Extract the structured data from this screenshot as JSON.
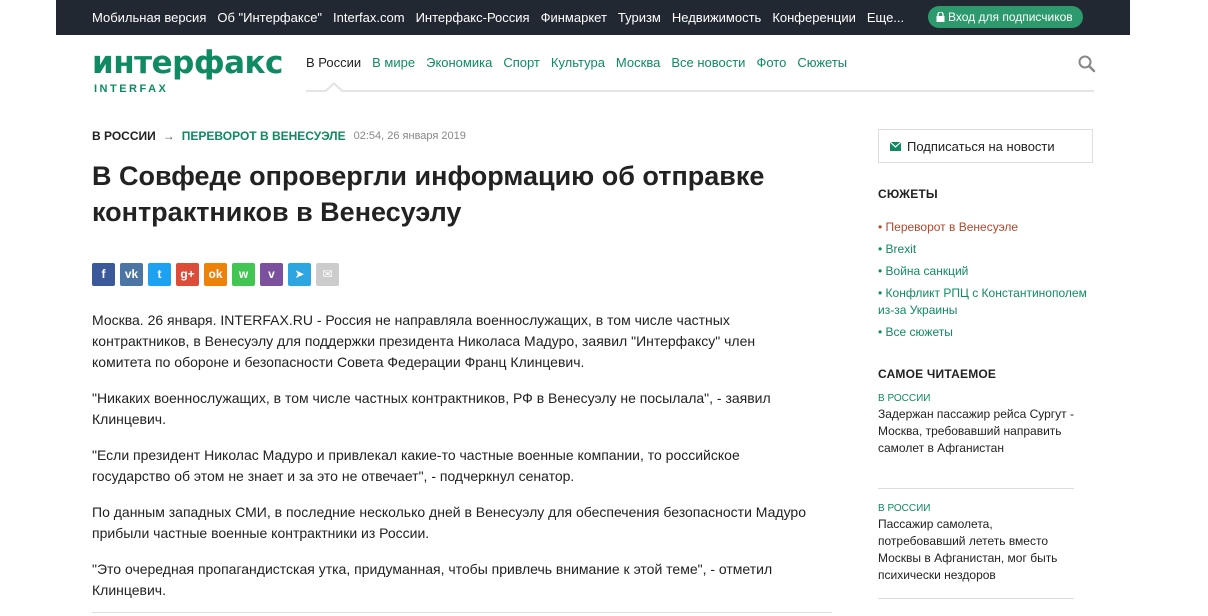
{
  "top_nav": {
    "links": [
      "Мобильная версия",
      "Об \"Интерфаксе\"",
      "Interfax.com",
      "Интерфакс-Россия",
      "Финмаркет",
      "Туризм",
      "Недвижимость",
      "Конференции",
      "Еще..."
    ],
    "subscribe_label": "Вход для подписчиков"
  },
  "logo": {
    "main": "интерфакс",
    "sub": "INTERFAX"
  },
  "main_nav": {
    "items": [
      "В России",
      "В мире",
      "Экономика",
      "Спорт",
      "Культура",
      "Москва",
      "Все новости",
      "Фото",
      "Сюжеты"
    ],
    "active_index": 0
  },
  "breadcrumb": {
    "section": "В РОССИИ",
    "arrow": "→",
    "story": "ПЕРЕВОРОТ В ВЕНЕСУЭЛЕ",
    "datetime": "02:54, 26 января 2019"
  },
  "article": {
    "headline": "В Совфеде опровергли информацию об отправке контрактников в Венесуэлу",
    "paragraphs": [
      "Москва. 26 января. INTERFAX.RU - Россия не направляла военнослужащих, в том числе частных контрактников, в Венесуэлу для поддержки президента Николаса Мадуро, заявил \"Интерфаксу\" член комитета по обороне и безопасности Совета Федерации Франц Клинцевич.",
      "\"Никаких военнослужащих, в том числе частных контрактников, РФ в Венесуэлу не посылала\", - заявил Клинцевич.",
      "\"Если президент Николас Мадуро и привлекал какие-то частные военные компании, то российское государство об этом не знает и за это не отвечает\", - подчеркнул сенатор.",
      "По данным западных СМИ, в последние несколько дней в Венесуэлу для обеспечения безопасности Мадуро прибыли частные военные контрактники из России.",
      "\"Это очередная пропагандистская утка, придуманная, чтобы привлечь внимание к этой теме\", - отметил Клинцевич."
    ]
  },
  "share_icons": [
    {
      "name": "facebook-icon",
      "glyph": "f",
      "color": "#3b5998"
    },
    {
      "name": "vk-icon",
      "glyph": "vk",
      "color": "#4c75a3"
    },
    {
      "name": "twitter-icon",
      "glyph": "t",
      "color": "#1da1f2"
    },
    {
      "name": "google-plus-icon",
      "glyph": "g+",
      "color": "#dd4b39"
    },
    {
      "name": "odnoklassniki-icon",
      "glyph": "ok",
      "color": "#ee8208"
    },
    {
      "name": "whatsapp-icon",
      "glyph": "w",
      "color": "#43c553"
    },
    {
      "name": "viber-icon",
      "glyph": "v",
      "color": "#7b519d"
    },
    {
      "name": "telegram-icon",
      "glyph": "➤",
      "color": "#2ca5e0"
    },
    {
      "name": "email-icon",
      "glyph": "✉",
      "color": "#cccccc"
    }
  ],
  "sidebar": {
    "subscribe_label": "Подписаться на новости",
    "stories_heading": "СЮЖЕТЫ",
    "stories": [
      "• Переворот в Венесуэле",
      "• Brexit",
      "• Война санкций",
      "• Конфликт РПЦ с Константинополем из-за Украины",
      "• Все сюжеты"
    ],
    "most_read_heading": "САМОЕ ЧИТАЕМОЕ",
    "most_read": [
      {
        "section": "В РОССИИ",
        "title": "Задержан пассажир рейса Сургут - Москва, требовавший направить самолет в Афганистан"
      },
      {
        "section": "В РОССИИ",
        "title": "Пассажир самолета, потребовавший лететь вместо Москвы в Афганистан, мог быть психически нездоров"
      }
    ]
  },
  "colors": {
    "brand_green": "#0f8a63",
    "topbar_bg": "#222831",
    "subscribe_btn": "#2d9a6d",
    "current_story": "#b3472b"
  }
}
